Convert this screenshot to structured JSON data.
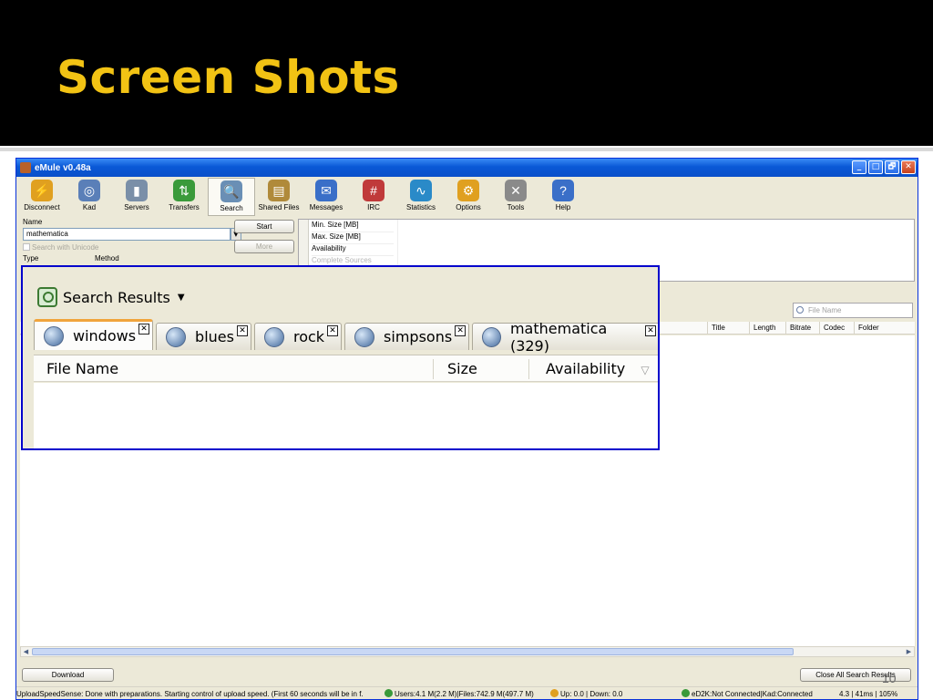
{
  "slide": {
    "title": "Screen Shots",
    "page_number": "10"
  },
  "window": {
    "title": "eMule v0.48a",
    "buttons": [
      "_",
      "□",
      "🗗",
      "✕"
    ]
  },
  "toolbar": {
    "items": [
      {
        "label": "Disconnect",
        "icon": "lightning-disconnect-icon",
        "color": "#e0a020",
        "glyph": "⚡"
      },
      {
        "label": "Kad",
        "icon": "kad-network-icon",
        "color": "#5a7fb8",
        "glyph": "◎"
      },
      {
        "label": "Servers",
        "icon": "servers-icon",
        "color": "#7a8fa8",
        "glyph": "▮"
      },
      {
        "label": "Transfers",
        "icon": "transfers-icon",
        "color": "#3a9a3a",
        "glyph": "⇅"
      },
      {
        "label": "Search",
        "icon": "search-icon",
        "color": "#6a8fb5",
        "glyph": "🔍"
      },
      {
        "label": "Shared Files",
        "icon": "shared-files-icon",
        "color": "#b08a3a",
        "glyph": "▤"
      },
      {
        "label": "Messages",
        "icon": "messages-icon",
        "color": "#3a6fc8",
        "glyph": "✉"
      },
      {
        "label": "IRC",
        "icon": "irc-icon",
        "color": "#c03a3a",
        "glyph": "#"
      },
      {
        "label": "Statistics",
        "icon": "statistics-icon",
        "color": "#2a8ac8",
        "glyph": "∿"
      },
      {
        "label": "Options",
        "icon": "options-gear-icon",
        "color": "#e0a020",
        "glyph": "⚙"
      },
      {
        "label": "Tools",
        "icon": "tools-icon",
        "color": "#8a8a8a",
        "glyph": "✕"
      },
      {
        "label": "Help",
        "icon": "help-icon",
        "color": "#3a6fc8",
        "glyph": "?"
      }
    ]
  },
  "search_panel": {
    "name_label": "Name",
    "name_value": "mathematica",
    "unicode_label": "Search with Unicode",
    "type_label": "Type",
    "method_label": "Method",
    "start_label": "Start",
    "more_label": "More",
    "params": [
      "Min. Size [MB]",
      "Max. Size [MB]",
      "Availability",
      "Complete Sources"
    ]
  },
  "results": {
    "filter_placeholder": "File Name",
    "columns": [
      "Title",
      "Length",
      "Bitrate",
      "Codec",
      "Folder"
    ]
  },
  "zoom": {
    "title": "Search Results",
    "tabs": [
      "windows",
      "blues",
      "rock",
      "simpsons",
      "mathematica (329)"
    ],
    "active_tab": 0,
    "columns": [
      "File Name",
      "Size",
      "Availability"
    ],
    "sort_glyph": "▽"
  },
  "bottom": {
    "download_label": "Download",
    "close_all_label": "Close All Search Results"
  },
  "statusbar": {
    "message": "UploadSpeedSense: Done with preparations. Starting control of upload speed. (First 60 seconds will be in f.",
    "users": "Users:4.1 M(2.2 M)|Files:742.9 M(497.7 M)",
    "speed": "Up: 0.0 | Down: 0.0",
    "network": "eD2K:Not Connected|Kad:Connected",
    "perf": "4.3 | 41ms | 105%"
  }
}
